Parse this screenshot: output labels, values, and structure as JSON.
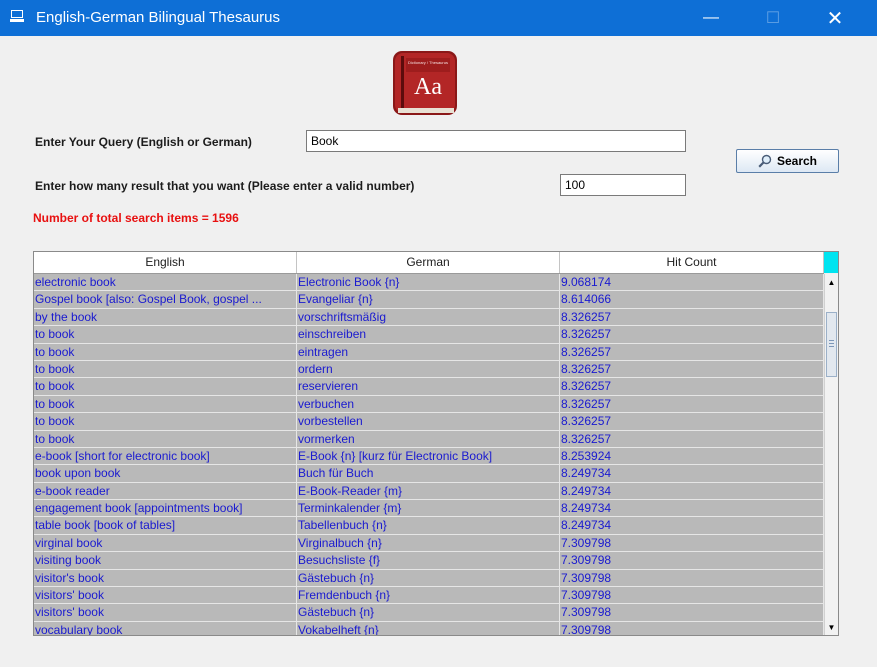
{
  "window": {
    "title": "English-German Bilingual Thesaurus",
    "minimize_glyph": "—",
    "maximize_glyph": "☐",
    "close_glyph": "✕"
  },
  "logo": {
    "top_text": "Dictionary / Thesaurus",
    "letters": "Aa"
  },
  "form": {
    "query_label": "Enter Your Query (English or German)",
    "query_value": "Book",
    "count_label": "Enter how many result that you want (Please enter a valid number)",
    "count_value": "100",
    "search_label": "Search",
    "total_text": "Number of total search items = 1596"
  },
  "table": {
    "headers": [
      "English",
      "German",
      "Hit Count"
    ],
    "rows": [
      [
        "electronic book",
        "Electronic Book {n}",
        "9.068174"
      ],
      [
        "Gospel book [also: Gospel Book, gospel ...",
        "Evangeliar {n}",
        "8.614066"
      ],
      [
        "by the book",
        "vorschriftsmäßig",
        "8.326257"
      ],
      [
        "to book",
        "einschreiben",
        "8.326257"
      ],
      [
        "to book",
        "eintragen",
        "8.326257"
      ],
      [
        "to book",
        "ordern",
        "8.326257"
      ],
      [
        "to book",
        "reservieren",
        "8.326257"
      ],
      [
        "to book",
        "verbuchen",
        "8.326257"
      ],
      [
        "to book",
        "vorbestellen",
        "8.326257"
      ],
      [
        "to book",
        "vormerken",
        "8.326257"
      ],
      [
        "e-book [short for electronic book]",
        "E-Book {n} [kurz für Electronic Book]",
        "8.253924"
      ],
      [
        "book upon book",
        "Buch für Buch",
        "8.249734"
      ],
      [
        "e-book reader",
        "E-Book-Reader {m}",
        "8.249734"
      ],
      [
        "engagement book [appointments book]",
        "Terminkalender {m}",
        "8.249734"
      ],
      [
        "table book [book of tables]",
        "Tabellenbuch {n}",
        "8.249734"
      ],
      [
        "virginal book",
        "Virginalbuch {n}",
        "7.309798"
      ],
      [
        "visiting book",
        "Besuchsliste {f}",
        "7.309798"
      ],
      [
        "visitor's book",
        "Gästebuch {n}",
        "7.309798"
      ],
      [
        "visitors' book",
        "Fremdenbuch {n}",
        "7.309798"
      ],
      [
        "visitors' book",
        "Gästebuch {n}",
        "7.309798"
      ],
      [
        "vocabulary book",
        "Vokabelheft {n}",
        "7.309798"
      ]
    ]
  },
  "colors": {
    "titlebar": "#0e6fd6",
    "cell_background": "#b9b9b9",
    "cell_text": "#1a1ad0",
    "total_text": "#e81010",
    "header_corner": "#00e4f0"
  }
}
